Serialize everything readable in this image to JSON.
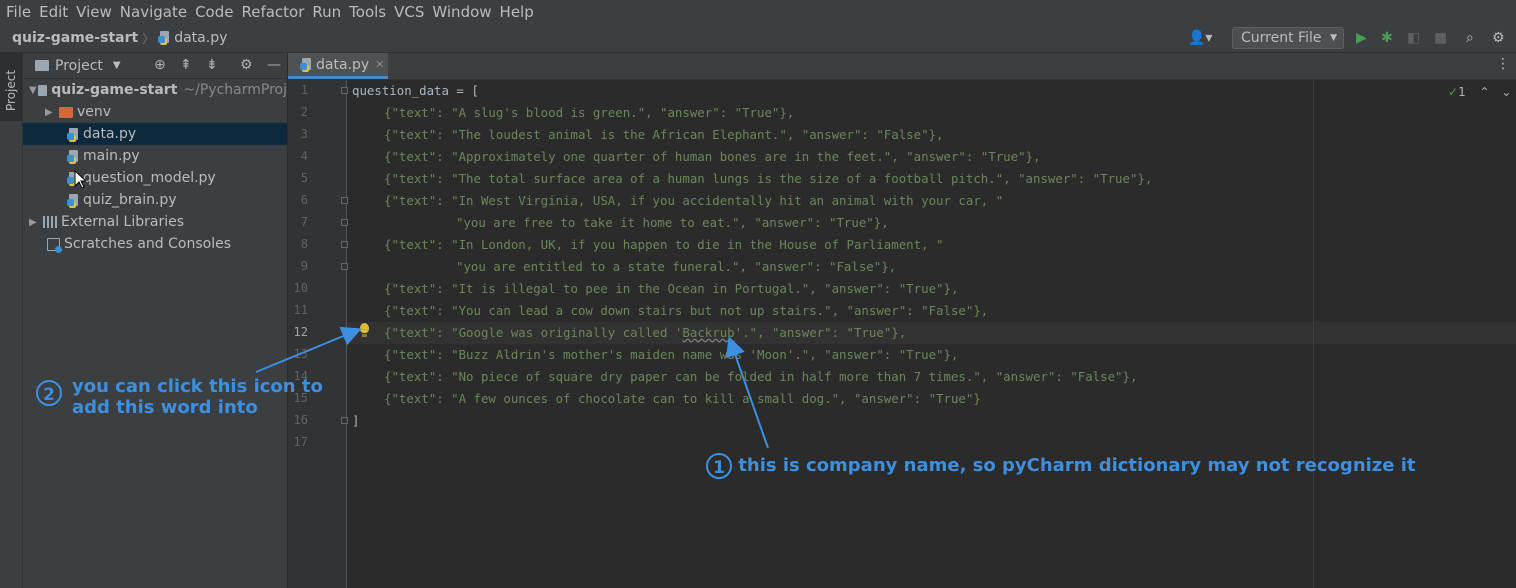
{
  "menu": [
    "File",
    "Edit",
    "View",
    "Navigate",
    "Code",
    "Refactor",
    "Run",
    "Tools",
    "VCS",
    "Window",
    "Help"
  ],
  "breadcrumb": {
    "project": "quiz-game-start",
    "file": "data.py"
  },
  "toolbar": {
    "run_config": "Current File"
  },
  "sidebar": {
    "strip_label": "Project",
    "title": "Project"
  },
  "tree": {
    "root_name": "quiz-game-start",
    "root_path": "~/PycharmProj",
    "venv": "venv",
    "files": [
      "data.py",
      "main.py",
      "question_model.py",
      "quiz_brain.py"
    ],
    "external": "External Libraries",
    "scratches": "Scratches and Consoles"
  },
  "editor": {
    "tab": "data.py",
    "line_numbers": [
      "1",
      "2",
      "3",
      "4",
      "5",
      "6",
      "7",
      "8",
      "9",
      "10",
      "11",
      "12",
      "13",
      "14",
      "15",
      "16",
      "17"
    ],
    "inspection_count": "1"
  },
  "code": {
    "l1": "question_data = [",
    "l2": "{\"text\": \"A slug's blood is green.\", \"answer\": \"True\"},",
    "l3": "{\"text\": \"The loudest animal is the African Elephant.\", \"answer\": \"False\"},",
    "l4": "{\"text\": \"Approximately one quarter of human bones are in the feet.\", \"answer\": \"True\"},",
    "l5": "{\"text\": \"The total surface area of a human lungs is the size of a football pitch.\", \"answer\": \"True\"},",
    "l6": "{\"text\": \"In West Virginia, USA, if you accidentally hit an animal with your car, \"",
    "l7": "\"you are free to take it home to eat.\", \"answer\": \"True\"},",
    "l8": "{\"text\": \"In London, UK, if you happen to die in the House of Parliament, \"",
    "l9": "\"you are entitled to a state funeral.\", \"answer\": \"False\"},",
    "l10": "{\"text\": \"It is illegal to pee in the Ocean in Portugal.\", \"answer\": \"True\"},",
    "l11": "{\"text\": \"You can lead a cow down stairs but not up stairs.\", \"answer\": \"False\"},",
    "l12_pre": "{\"text\": \"Google was originally called '",
    "l12_word": "Backrub",
    "l12_post": "'.\", \"answer\": \"True\"},",
    "l13": "{\"text\": \"Buzz Aldrin's mother's maiden name was 'Moon'.\", \"answer\": \"True\"},",
    "l14": "{\"text\": \"No piece of square dry paper can be folded in half more than 7 times.\", \"answer\": \"False\"},",
    "l15": "{\"text\": \"A few ounces of chocolate can to kill a small dog.\", \"answer\": \"True\"}",
    "l16": "]"
  },
  "annotations": {
    "a1_num": "1",
    "a1_text": "this is company name, so pyCharm dictionary may not recognize it",
    "a2_num": "2",
    "a2_line1": "you can click this icon to",
    "a2_line2": "add this word into"
  },
  "colors": {
    "accent": "#3d8fe0",
    "string": "#6a8759",
    "background": "#2b2b2b"
  }
}
